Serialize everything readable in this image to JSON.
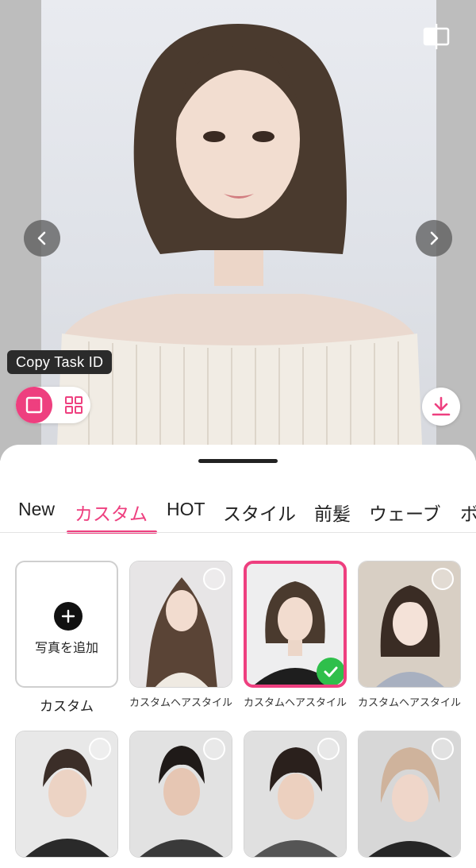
{
  "preview": {
    "copy_task_label": "Copy Task ID"
  },
  "icons": {
    "compare": "compare-split-icon",
    "prev": "chevron-left-icon",
    "next": "chevron-right-icon",
    "single_view": "single-view-icon",
    "grid_view": "grid-view-icon",
    "download": "download-icon",
    "add": "plus-icon",
    "check": "check-icon"
  },
  "colors": {
    "accent": "#ee3f7f",
    "check": "#2fbf4b"
  },
  "tabs": [
    {
      "label": "New",
      "active": false
    },
    {
      "label": "カスタム",
      "active": true
    },
    {
      "label": "HOT",
      "active": false
    },
    {
      "label": "スタイル",
      "active": false
    },
    {
      "label": "前髪",
      "active": false
    },
    {
      "label": "ウェーブ",
      "active": false
    },
    {
      "label": "ボ",
      "active": false
    }
  ],
  "add_card": {
    "label": "写真を追加",
    "caption": "カスタム"
  },
  "styles_row1": [
    {
      "caption": "カスタムヘアスタイル",
      "selected": false
    },
    {
      "caption": "カスタムヘアスタイル",
      "selected": true
    },
    {
      "caption": "カスタムヘアスタイル",
      "selected": false
    }
  ]
}
